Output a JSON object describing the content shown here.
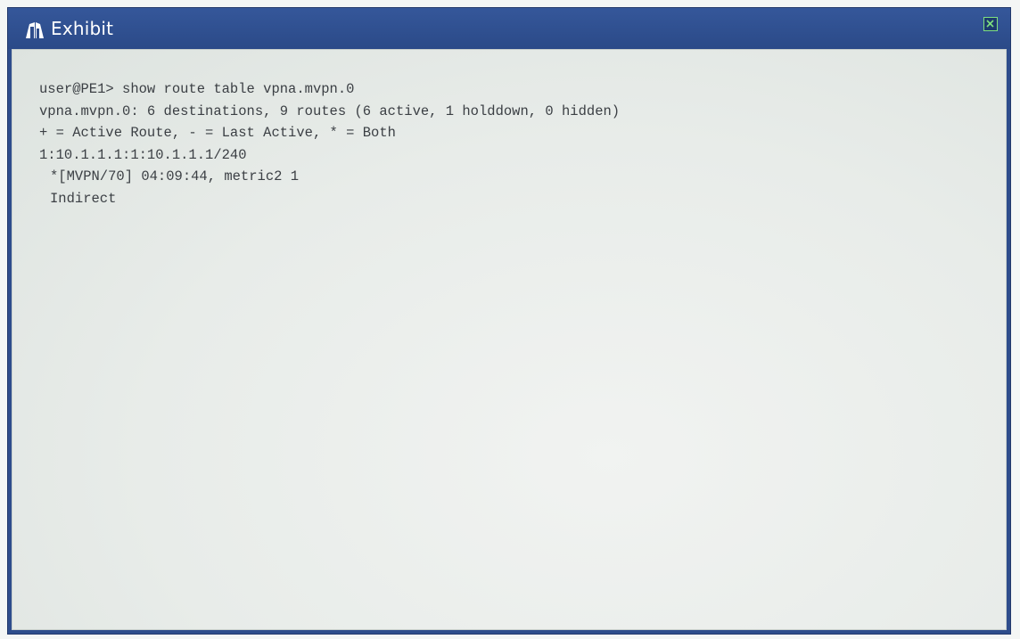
{
  "window": {
    "title": "Exhibit",
    "title_icon": "podium-icon",
    "close_icon": "close-icon",
    "colors": {
      "titlebar": "#2e4d8c",
      "close_accent": "#7fe07f"
    }
  },
  "terminal": {
    "lines": [
      "user@PE1> show route table vpna.mvpn.0",
      "vpna.mvpn.0: 6 destinations, 9 routes (6 active, 1 holddown, 0 hidden)",
      "+ = Active Route, - = Last Active, * = Both",
      "1:10.1.1.1:1:10.1.1.1/240",
      "*[MVPN/70] 04:09:44, metric2 1",
      "Indirect"
    ]
  }
}
